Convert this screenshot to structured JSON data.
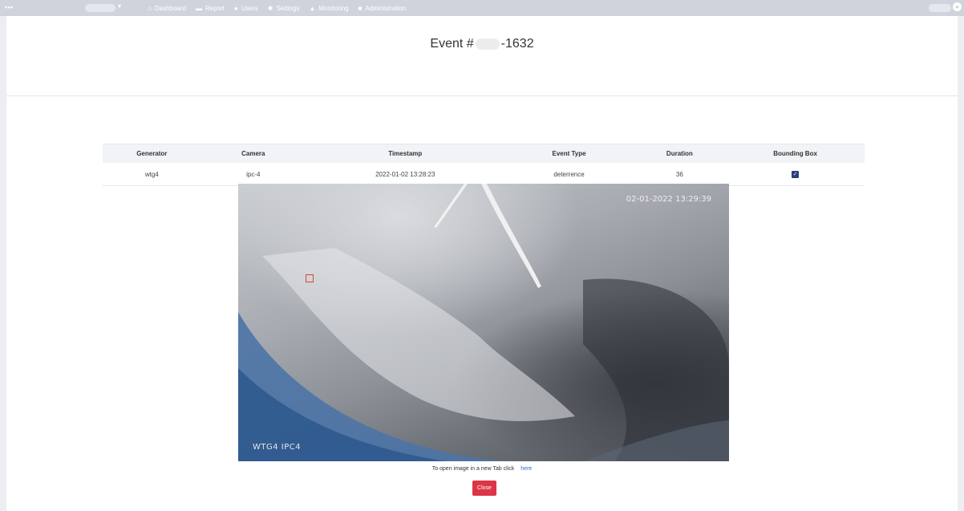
{
  "navbar": {
    "items": [
      {
        "label": "Dashboard",
        "icon": "home-icon",
        "glyph": "⌂"
      },
      {
        "label": "Report",
        "icon": "chart-icon",
        "glyph": "▬"
      },
      {
        "label": "Users",
        "icon": "user-icon",
        "glyph": "●"
      },
      {
        "label": "Settings",
        "icon": "gear-icon",
        "glyph": "✱"
      },
      {
        "label": "Monitoring",
        "icon": "warning-icon",
        "glyph": "▲"
      },
      {
        "label": "Administration",
        "icon": "lock-icon",
        "glyph": "■"
      }
    ]
  },
  "event": {
    "title_prefix": "Event #",
    "title_suffix": "-1632"
  },
  "table": {
    "headers": [
      "Generator",
      "Camera",
      "Timestamp",
      "Event Type",
      "Duration",
      "Bounding Box"
    ],
    "row": {
      "generator": "wtg4",
      "camera": "ipc-4",
      "timestamp": "2022-01-02 13:28:23",
      "event_type": "deterrence",
      "duration": "36",
      "bounding_box": true
    }
  },
  "image": {
    "overlay_timestamp": "02-01-2022 13:29:39",
    "overlay_label": "WTG4  IPC4"
  },
  "footer": {
    "open_text": "To open image in a new Tab click",
    "open_link": "here",
    "close_label": "Close"
  },
  "colors": {
    "navbar": "#cfd4dc",
    "close_button": "#dc3545",
    "link": "#2a6fd1",
    "checkbox": "#2b3d7a",
    "bounding_box": "#d2473f"
  }
}
